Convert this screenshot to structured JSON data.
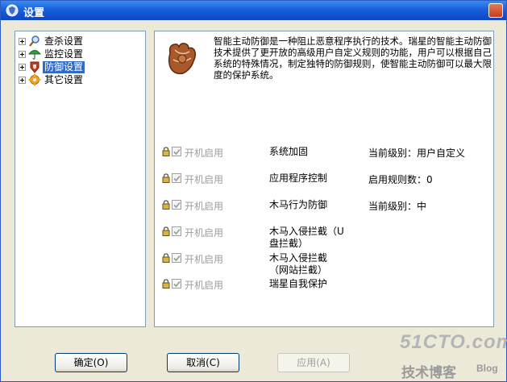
{
  "window": {
    "title": "设置"
  },
  "tree": {
    "items": [
      {
        "label": "查杀设置",
        "icon": "scan-magnifier-icon",
        "selected": false
      },
      {
        "label": "监控设置",
        "icon": "umbrella-monitor-icon",
        "selected": false
      },
      {
        "label": "防御设置",
        "icon": "defense-shield-icon",
        "selected": true
      },
      {
        "label": "其它设置",
        "icon": "gear-settings-icon",
        "selected": false
      }
    ]
  },
  "panel": {
    "description": "智能主动防御是一种阻止恶意程序执行的技术。瑞星的智能主动防御技术提供了更开放的高级用户自定义规则的功能，用户可以根据自己系统的特殊情况，制定独特的防御规则，使智能主动防御可以最大限度的保护系统。",
    "rows": [
      {
        "checkbox_label": "开机启用",
        "name": "系统加固",
        "status": "当前级别：用户自定义"
      },
      {
        "checkbox_label": "开机启用",
        "name": "应用程序控制",
        "status": "启用规则数：0"
      },
      {
        "checkbox_label": "开机启用",
        "name": "木马行为防御",
        "status": "当前级别：中"
      },
      {
        "checkbox_label": "开机启用",
        "name": "木马入侵拦截（U盘拦截）",
        "status": ""
      },
      {
        "checkbox_label": "开机启用",
        "name": "木马入侵拦截（网站拦截）",
        "status": ""
      },
      {
        "checkbox_label": "开机启用",
        "name": "瑞星自我保护",
        "status": ""
      }
    ]
  },
  "buttons": {
    "ok": "确定(O)",
    "cancel": "取消(C)",
    "apply": "应用(A)"
  },
  "watermark": {
    "line1": "51CTO.com",
    "line2": "技术博客",
    "line3": "Blog"
  }
}
